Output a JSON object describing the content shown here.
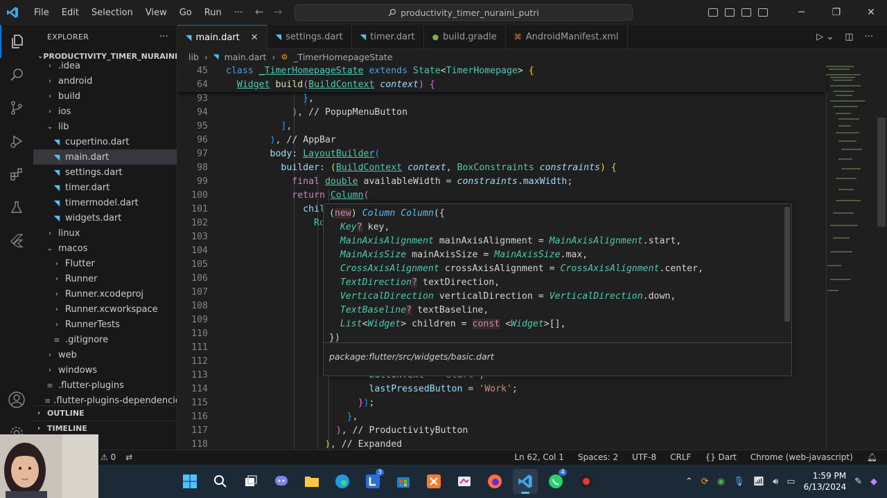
{
  "titlebar": {
    "menu": [
      "File",
      "Edit",
      "Selection",
      "View",
      "Go",
      "Run",
      "···"
    ],
    "search_text": "productivity_timer_nuraini_putri"
  },
  "sidebar": {
    "title": "EXPLORER",
    "more": "···",
    "project": "PRODUCTIVITY_TIMER_NURAINI_...",
    "items": [
      {
        "label": ".idea",
        "kind": "folder",
        "indent": 1
      },
      {
        "label": "android",
        "kind": "folder",
        "indent": 1
      },
      {
        "label": "build",
        "kind": "folder",
        "indent": 1
      },
      {
        "label": "ios",
        "kind": "folder",
        "indent": 1
      },
      {
        "label": "lib",
        "kind": "folder-open",
        "indent": 1
      },
      {
        "label": "cupertino.dart",
        "kind": "dart",
        "indent": 2
      },
      {
        "label": "main.dart",
        "kind": "dart",
        "indent": 2,
        "selected": true
      },
      {
        "label": "settings.dart",
        "kind": "dart",
        "indent": 2
      },
      {
        "label": "timer.dart",
        "kind": "dart",
        "indent": 2
      },
      {
        "label": "timermodel.dart",
        "kind": "dart",
        "indent": 2
      },
      {
        "label": "widgets.dart",
        "kind": "dart",
        "indent": 2
      },
      {
        "label": "linux",
        "kind": "folder",
        "indent": 1
      },
      {
        "label": "macos",
        "kind": "folder-open",
        "indent": 1
      },
      {
        "label": "Flutter",
        "kind": "folder",
        "indent": 2
      },
      {
        "label": "Runner",
        "kind": "folder",
        "indent": 2
      },
      {
        "label": "Runner.xcodeproj",
        "kind": "folder",
        "indent": 2
      },
      {
        "label": "Runner.xcworkspace",
        "kind": "folder",
        "indent": 2
      },
      {
        "label": "RunnerTests",
        "kind": "folder",
        "indent": 2
      },
      {
        "label": ".gitignore",
        "kind": "file",
        "indent": 2
      },
      {
        "label": "web",
        "kind": "folder",
        "indent": 1
      },
      {
        "label": "windows",
        "kind": "folder",
        "indent": 1
      },
      {
        "label": ".flutter-plugins",
        "kind": "file",
        "indent": 1
      },
      {
        "label": ".flutter-plugins-dependencies",
        "kind": "file",
        "indent": 1
      }
    ],
    "outline": "OUTLINE",
    "timeline": "TIMELINE"
  },
  "tabs": [
    {
      "label": "main.dart",
      "icon": "dart",
      "active": true
    },
    {
      "label": "settings.dart",
      "icon": "dart"
    },
    {
      "label": "timer.dart",
      "icon": "dart"
    },
    {
      "label": "build.gradle",
      "icon": "gradle"
    },
    {
      "label": "AndroidManifest.xml",
      "icon": "xml"
    }
  ],
  "breadcrumb": [
    "lib",
    "main.dart",
    "_TimerHomepageState"
  ],
  "editor": {
    "lines": [
      {
        "n": "45",
        "sticky": true
      },
      {
        "n": "64",
        "sticky": true
      },
      {
        "n": "93"
      },
      {
        "n": "94"
      },
      {
        "n": "95"
      },
      {
        "n": "96"
      },
      {
        "n": "97"
      },
      {
        "n": "98"
      },
      {
        "n": "99"
      },
      {
        "n": "100"
      },
      {
        "n": "101"
      },
      {
        "n": "102"
      },
      {
        "n": "103"
      },
      {
        "n": "104"
      },
      {
        "n": "105"
      },
      {
        "n": "106"
      },
      {
        "n": "107"
      },
      {
        "n": "108"
      },
      {
        "n": "109"
      },
      {
        "n": "110"
      },
      {
        "n": "111"
      },
      {
        "n": "112"
      },
      {
        "n": "113"
      },
      {
        "n": "114"
      },
      {
        "n": "115"
      },
      {
        "n": "116"
      },
      {
        "n": "117"
      },
      {
        "n": "118"
      }
    ]
  },
  "hover": {
    "package": "package:flutter/src/widgets/basic.dart"
  },
  "statusbar": {
    "problems": "0",
    "position": "Ln 62, Col 1",
    "spaces": "Spaces: 2",
    "encoding": "UTF-8",
    "eol": "CRLF",
    "language": "{} Dart",
    "device": "Chrome (web-javascript)"
  },
  "taskbar": {
    "time": "1:59 PM",
    "date": "6/13/2024",
    "badge_l": "3",
    "badge_w": "4"
  },
  "colors": {
    "accent": "#0078d4",
    "taskbar": "#1c2a38"
  }
}
